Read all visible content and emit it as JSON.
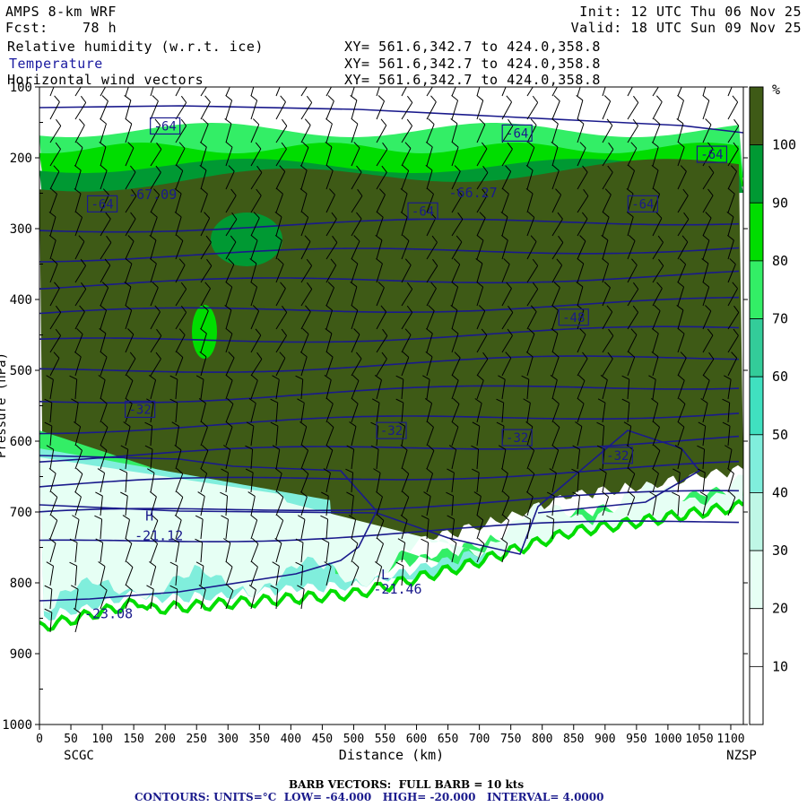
{
  "header": {
    "model": "AMPS 8-km WRF",
    "fcst_label": "Fcst:",
    "fcst_value": "78 h",
    "init": "Init: 12 UTC Thu 06 Nov 25",
    "valid": "Valid: 18 UTC Sun 09 Nov 25"
  },
  "layers": [
    {
      "name": "Relative humidity (w.r.t. ice)",
      "xy": "XY= 561.6,342.7 to 424.0,358.8"
    },
    {
      "name": "Temperature",
      "xy": "XY= 561.6,342.7 to 424.0,358.8"
    },
    {
      "name": "Horizontal wind vectors",
      "xy": "XY= 561.6,342.7 to 424.0,358.8"
    }
  ],
  "colors": {
    "contour": "#1a1a8c",
    "barb": "#000000",
    "rh_bins": [
      "#ffffff",
      "#ffffff",
      "#ffffff",
      "#e6fff4",
      "#bff7e6",
      "#80eedc",
      "#40e0c0",
      "#33cc99",
      "#33ee66",
      "#00dd00",
      "#009933",
      "#3e5a16"
    ]
  },
  "chart_data": {
    "type": "heatmap",
    "title": "Relative humidity (w.r.t. ice)",
    "xlabel": "Distance (km)",
    "ylabel": "Pressure (hPa)",
    "xlim": [
      0,
      1120
    ],
    "ylim": [
      1000,
      100
    ],
    "x_ticks": [
      0,
      50,
      100,
      150,
      200,
      250,
      300,
      350,
      400,
      450,
      500,
      550,
      600,
      650,
      700,
      750,
      800,
      850,
      900,
      950,
      1000,
      1050,
      1100
    ],
    "y_ticks": [
      100,
      200,
      300,
      400,
      500,
      600,
      700,
      800,
      900,
      1000
    ],
    "endpoints": {
      "left": "SCGC",
      "right": "NZSP"
    },
    "colorbar": {
      "unit": "%",
      "levels": [
        10,
        20,
        30,
        40,
        50,
        60,
        70,
        80,
        90,
        100
      ]
    },
    "temperature_contour_labels": [
      {
        "x": 200,
        "p": 155,
        "text": "-64"
      },
      {
        "x": 760,
        "p": 165,
        "text": "-64"
      },
      {
        "x": 1070,
        "p": 195,
        "text": "-64"
      },
      {
        "x": 100,
        "p": 265,
        "text": "-64"
      },
      {
        "x": 610,
        "p": 275,
        "text": "-64"
      },
      {
        "x": 960,
        "p": 265,
        "text": "-64"
      },
      {
        "x": 850,
        "p": 425,
        "text": "-48"
      },
      {
        "x": 160,
        "p": 555,
        "text": "-32"
      },
      {
        "x": 560,
        "p": 585,
        "text": "-32"
      },
      {
        "x": 760,
        "p": 595,
        "text": "-32"
      },
      {
        "x": 920,
        "p": 620,
        "text": "-32"
      }
    ],
    "annotations": [
      {
        "x": 180,
        "p": 258,
        "text": "-67.09"
      },
      {
        "x": 690,
        "p": 256,
        "text": "-66.27"
      },
      {
        "x": 175,
        "p": 712,
        "text": "H"
      },
      {
        "x": 190,
        "p": 740,
        "text": "-21.12"
      },
      {
        "x": 550,
        "p": 795,
        "text": "L"
      },
      {
        "x": 570,
        "p": 815,
        "text": "-21.46"
      },
      {
        "x": 110,
        "p": 850,
        "text": "-23.08"
      }
    ],
    "barbs": {
      "label": "BARB VECTORS:",
      "text": "FULL BARB = 10 kts"
    },
    "contours": {
      "units_label": "CONTOURS: UNITS=°C",
      "low": "LOW= -64.000",
      "high": "HIGH= -20.000",
      "interval": "INTERVAL= 4.0000"
    }
  }
}
